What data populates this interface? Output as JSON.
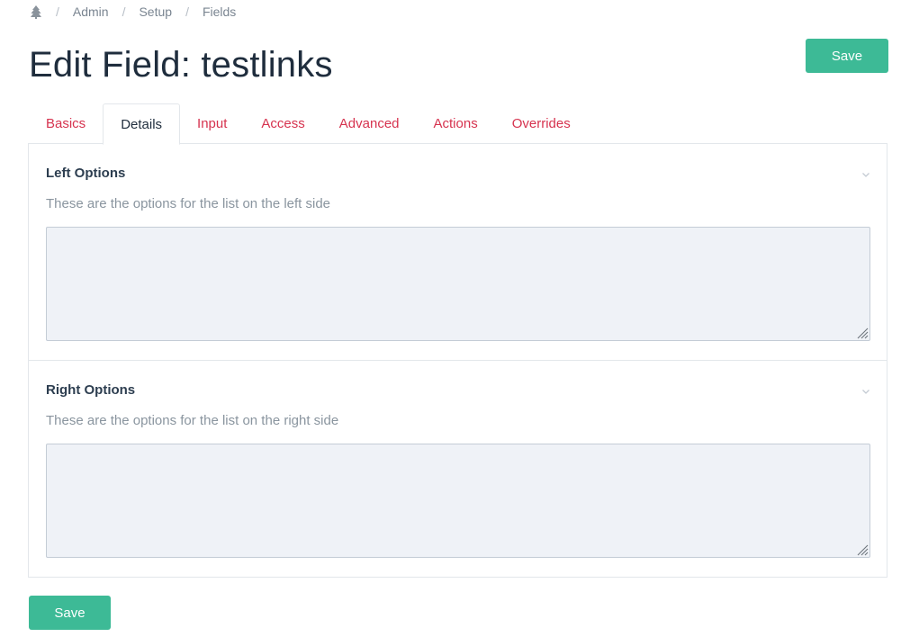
{
  "breadcrumb": {
    "home_icon": "tree-icon",
    "separator": "/",
    "items": [
      "Admin",
      "Setup",
      "Fields"
    ]
  },
  "page": {
    "title": "Edit Field: testlinks",
    "save_label": "Save"
  },
  "tabs": [
    {
      "label": "Basics",
      "active": false
    },
    {
      "label": "Details",
      "active": true
    },
    {
      "label": "Input",
      "active": false
    },
    {
      "label": "Access",
      "active": false
    },
    {
      "label": "Advanced",
      "active": false
    },
    {
      "label": "Actions",
      "active": false
    },
    {
      "label": "Overrides",
      "active": false
    }
  ],
  "sections": [
    {
      "title": "Left Options",
      "description": "These are the options for the list on the left side",
      "value": ""
    },
    {
      "title": "Right Options",
      "description": "These are the options for the list on the right side",
      "value": ""
    }
  ],
  "footer": {
    "save_label": "Save"
  },
  "colors": {
    "accent": "#3dba96",
    "tab_link": "#d6334f",
    "textarea_bg": "#eff2f7"
  }
}
